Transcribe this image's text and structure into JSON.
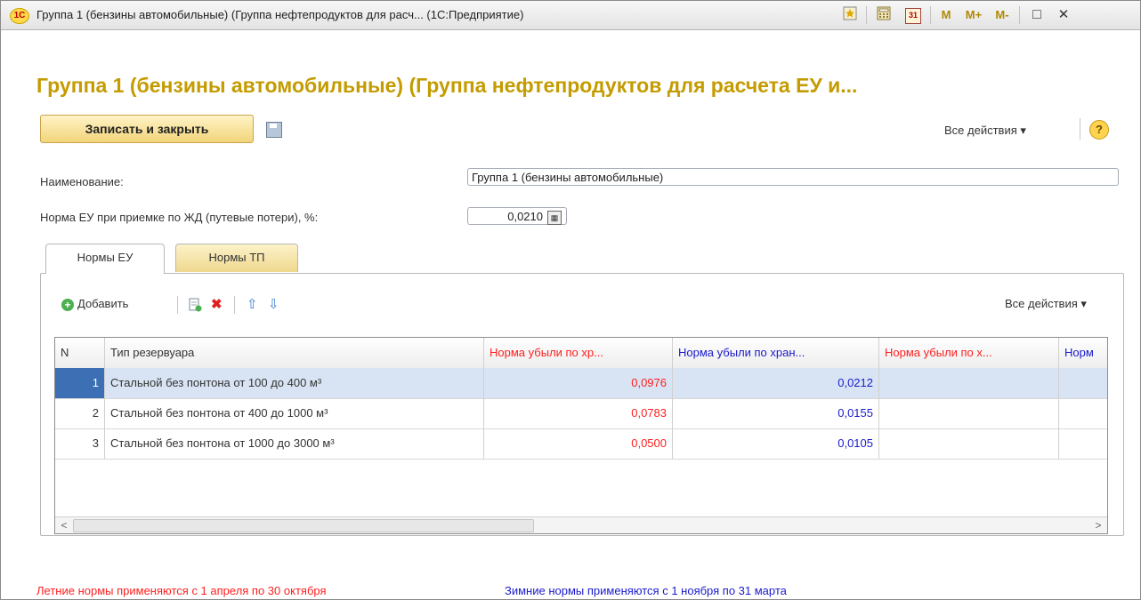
{
  "window": {
    "logo": "1С",
    "title": "Группа 1 (бензины автомобильные) (Группа нефтепродуктов для расч...  (1С:Предприятие)",
    "toolbar": {
      "m": "M",
      "m_plus": "M+",
      "m_minus": "M-",
      "calendar": "31",
      "restore": "□",
      "close": "✕"
    }
  },
  "form": {
    "heading": "Группа 1 (бензины автомобильные) (Группа нефтепродуктов для расчета ЕУ и...",
    "save_close_label": "Записать и закрыть",
    "all_actions_label": "Все действия ▾",
    "help_label": "?",
    "name_label": "Наименование:",
    "name_value": "Группа 1 (бензины автомобильные)",
    "rail_label": "Норма ЕУ при приемке по ЖД (путевые потери), %:",
    "rail_value": "0,0210"
  },
  "tabs": [
    {
      "label": "Нормы ЕУ"
    },
    {
      "label": "Нормы ТП"
    }
  ],
  "table_toolbar": {
    "add_label": "Добавить",
    "all_actions_label": "Все действия ▾"
  },
  "table": {
    "headers": [
      "N",
      "Тип резервуара",
      "Норма убыли по хр...",
      "Норма убыли по хран...",
      "Норма убыли по х...",
      "Норм"
    ],
    "rows": [
      {
        "n": "1",
        "type": "Стальной без понтона от 100 до 400 м³",
        "v1": "0,0976",
        "v2": "0,0212",
        "v3": ""
      },
      {
        "n": "2",
        "type": "Стальной без понтона от 400 до 1000 м³",
        "v1": "0,0783",
        "v2": "0,0155",
        "v3": ""
      },
      {
        "n": "3",
        "type": "Стальной без понтона от 1000 до 3000 м³",
        "v1": "0,0500",
        "v2": "0,0105",
        "v3": ""
      }
    ]
  },
  "notes": {
    "summer": "Летние нормы применяются с 1 апреля по 30 октября",
    "winter": "Зимние нормы применяются с 1 ноября по 31 марта",
    "summer_color": "#ff1f1f",
    "winter_color": "#1a1acc"
  }
}
